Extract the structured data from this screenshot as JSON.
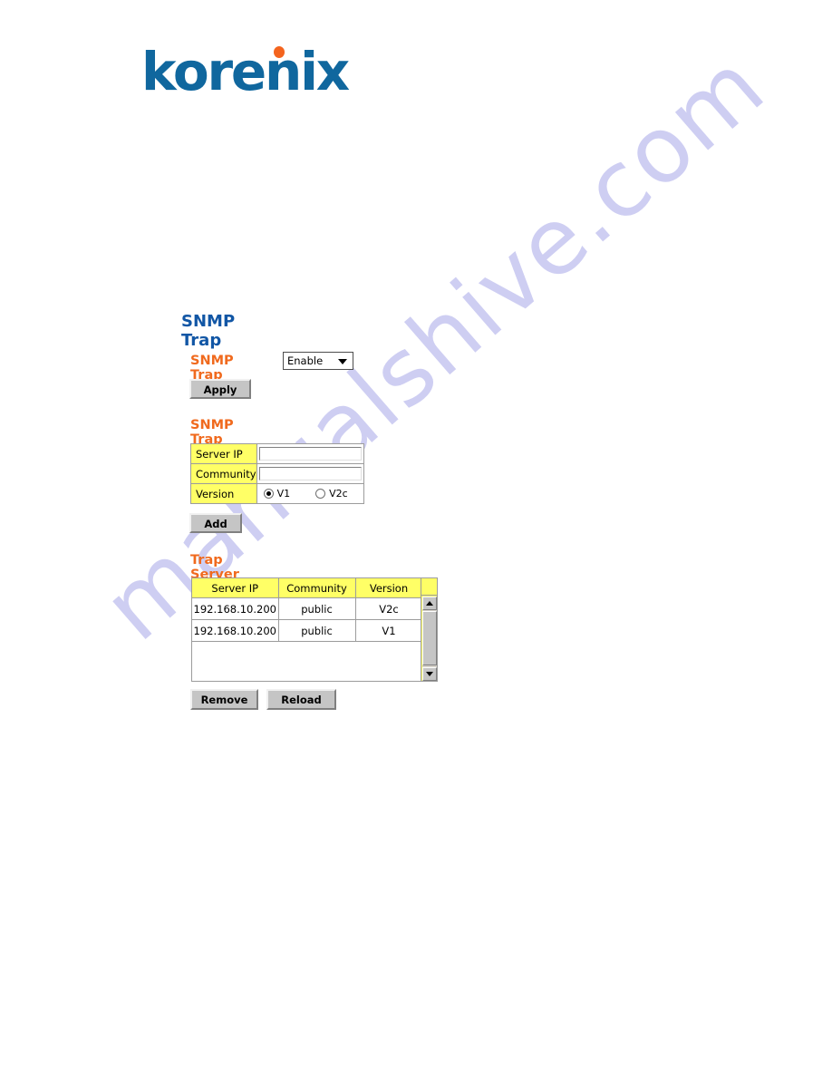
{
  "brand": {
    "logo_text": "korenix",
    "logo_blue": "#10679e",
    "logo_orange": "#f4641e"
  },
  "watermark": {
    "text": "manualshive.com",
    "color": "#ccccf2"
  },
  "page": {
    "title": "SNMP Trap",
    "title_color": "#1156a5",
    "section_color": "#f06a1e"
  },
  "trap_setting": {
    "label": "SNMP Trap",
    "select_value": "Enable",
    "select_options": [
      "Enable"
    ],
    "apply_label": "Apply"
  },
  "trap_server": {
    "heading": "SNMP Trap Server",
    "fields": {
      "server_ip_label": "Server IP",
      "server_ip_value": "",
      "community_label": "Community",
      "community_value": "",
      "version_label": "Version",
      "version_options": [
        {
          "label": "V1",
          "checked": true
        },
        {
          "label": "V2c",
          "checked": false
        }
      ]
    },
    "add_label": "Add"
  },
  "trap_profile": {
    "heading": "Trap Server Profile",
    "columns": [
      "Server IP",
      "Community",
      "Version"
    ],
    "rows": [
      {
        "server_ip": "192.168.10.200",
        "community": "public",
        "version": "V2c"
      },
      {
        "server_ip": "192.168.10.200",
        "community": "public",
        "version": "V1"
      }
    ],
    "remove_label": "Remove",
    "reload_label": "Reload"
  }
}
